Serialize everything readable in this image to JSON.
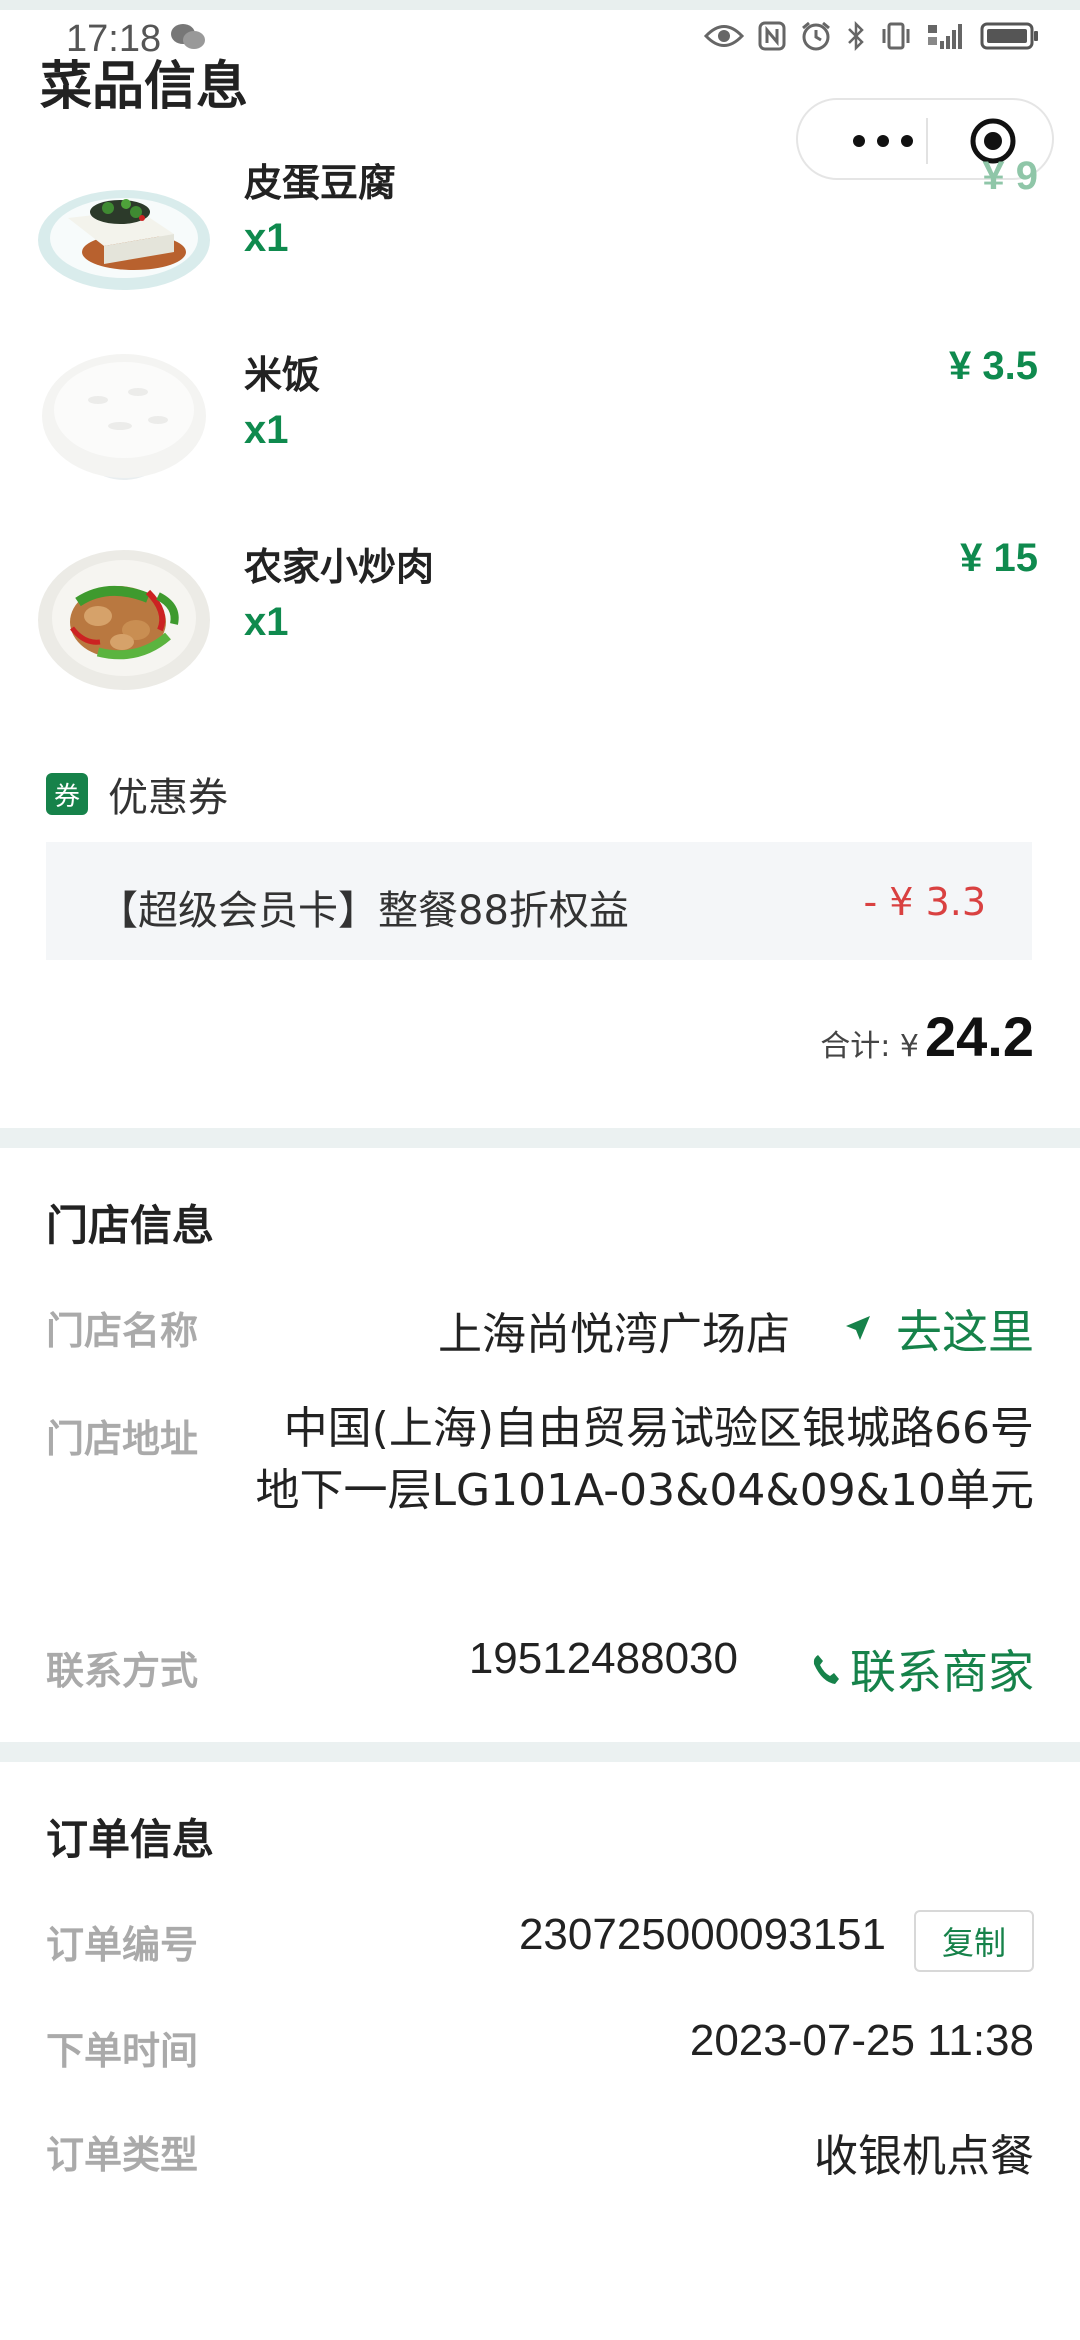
{
  "status_bar": {
    "time": "17:18"
  },
  "header": {
    "title": "菜品信息"
  },
  "dishes": [
    {
      "name": "皮蛋豆腐",
      "qty": "x1",
      "price": "¥ 9"
    },
    {
      "name": "米饭",
      "qty": "x1",
      "price": "¥ 3.5"
    },
    {
      "name": "农家小炒肉",
      "qty": "x1",
      "price": "¥ 15"
    }
  ],
  "coupon": {
    "badge": "券",
    "title": "优惠券",
    "text": "【超级会员卡】整餐88折权益",
    "amount": "- ¥ 3.3"
  },
  "total": {
    "label": "合计: ¥",
    "value": "24.2"
  },
  "store": {
    "title": "门店信息",
    "name_label": "门店名称",
    "name": "上海尚悦湾广场店",
    "navigate": "去这里",
    "address_label": "门店地址",
    "address": "中国(上海)自由贸易试验区银城路66号地下一层LG101A-03&04&09&10单元",
    "contact_label": "联系方式",
    "phone": "19512488030",
    "contact_action": "联系商家"
  },
  "order": {
    "title": "订单信息",
    "number_label": "订单编号",
    "number": "230725000093151",
    "copy": "复制",
    "time_label": "下单时间",
    "time": "2023-07-25 11:38",
    "type_label": "订单类型",
    "type": "收银机点餐"
  },
  "colors": {
    "accent": "#16824a",
    "price_green": "#0f8a4e",
    "discount_red": "#d94141"
  }
}
